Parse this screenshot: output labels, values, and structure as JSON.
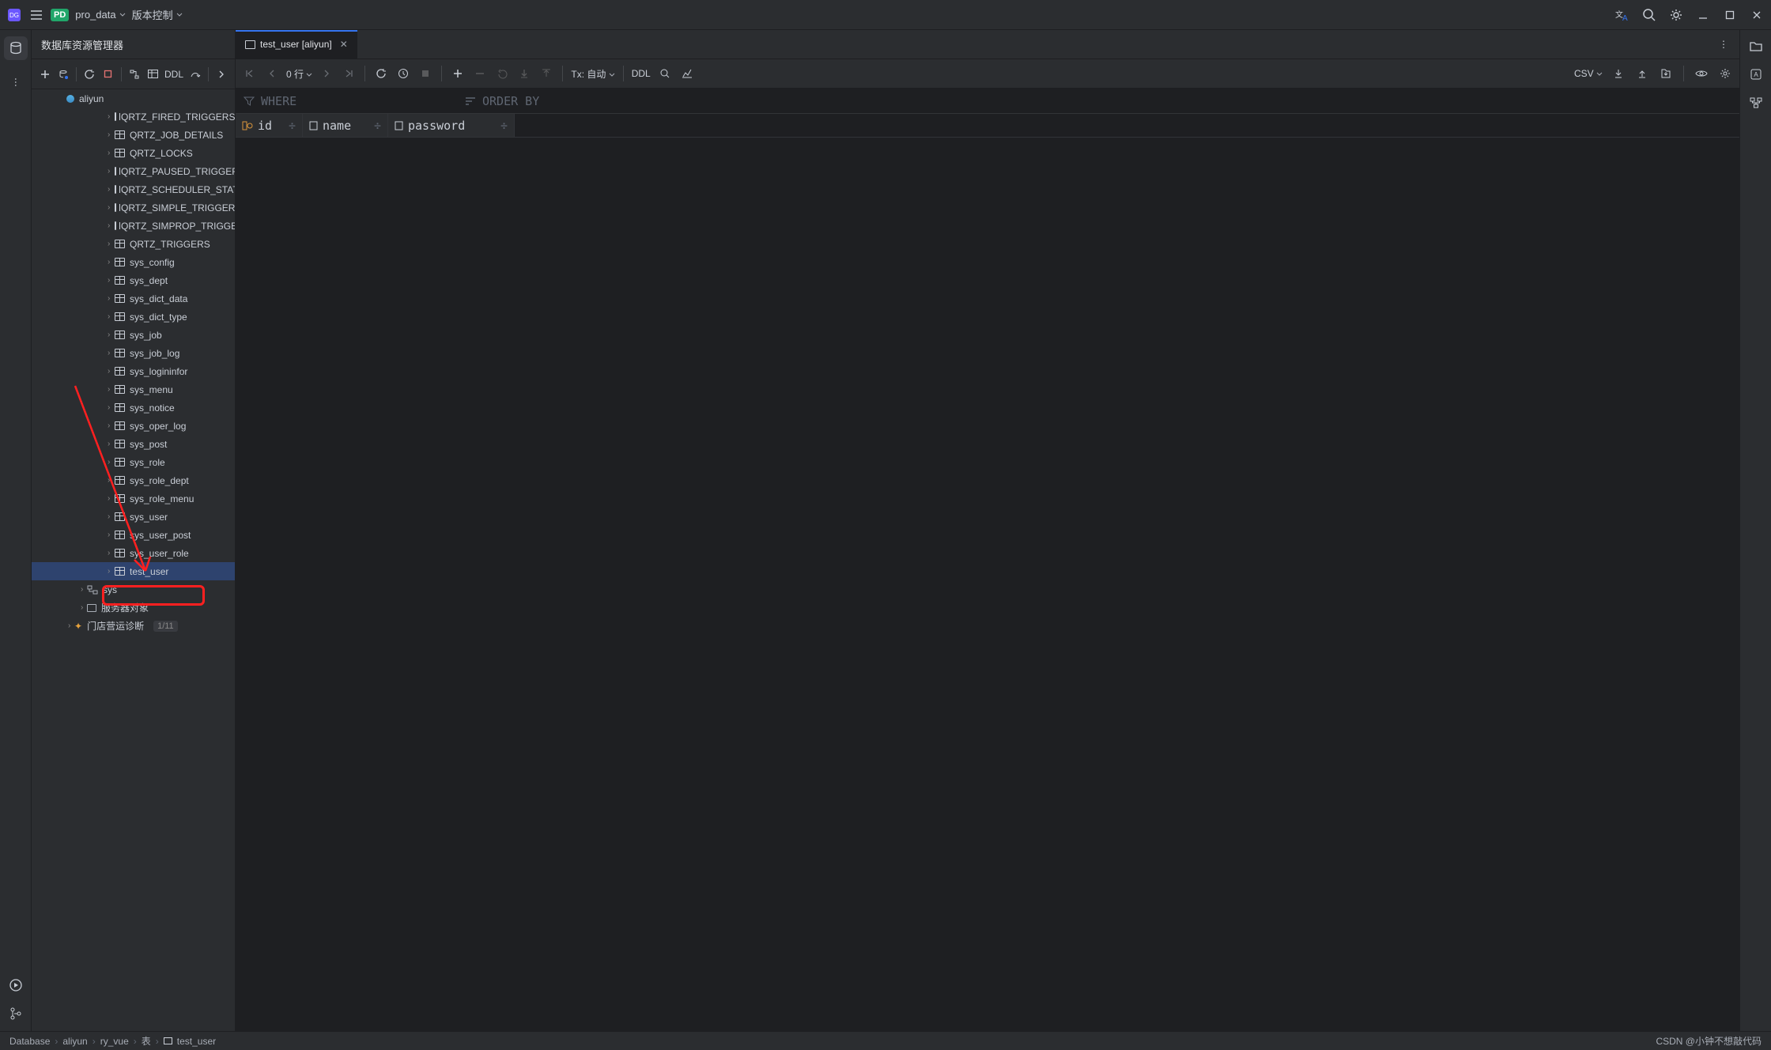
{
  "titlebar": {
    "pd_badge": "PD",
    "project": "pro_data",
    "vcs": "版本控制"
  },
  "sidebar": {
    "header": "数据库资源管理器",
    "toolbar": {
      "ddl": "DDL"
    },
    "datasource": "aliyun",
    "tables": [
      "QRTZ_FIRED_TRIGGERS",
      "QRTZ_JOB_DETAILS",
      "QRTZ_LOCKS",
      "QRTZ_PAUSED_TRIGGER_GRPS",
      "QRTZ_SCHEDULER_STATE",
      "QRTZ_SIMPLE_TRIGGERS",
      "QRTZ_SIMPROP_TRIGGERS",
      "QRTZ_TRIGGERS",
      "sys_config",
      "sys_dept",
      "sys_dict_data",
      "sys_dict_type",
      "sys_job",
      "sys_job_log",
      "sys_logininfor",
      "sys_menu",
      "sys_notice",
      "sys_oper_log",
      "sys_post",
      "sys_role",
      "sys_role_dept",
      "sys_role_menu",
      "sys_user",
      "sys_user_post",
      "sys_user_role",
      "test_user"
    ],
    "selected_table": "test_user",
    "sys_schema": "sys",
    "server_objects": "服务器对象",
    "extra_ds": "门店营运诊断",
    "extra_ds_badge": "1/11"
  },
  "tab": {
    "title": "test_user [aliyun]"
  },
  "data_toolbar": {
    "rows": "0 行",
    "tx": "Tx: 自动",
    "ddl": "DDL",
    "csv": "CSV"
  },
  "filter": {
    "where_label": "WHERE",
    "order_label": "ORDER BY"
  },
  "columns": [
    {
      "name": "id"
    },
    {
      "name": "name"
    },
    {
      "name": "password"
    }
  ],
  "breadcrumb": {
    "root": "Database",
    "ds": "aliyun",
    "schema": "ry_vue",
    "tables": "表",
    "table": "test_user"
  },
  "watermark": "CSDN @小钟不想敲代码"
}
